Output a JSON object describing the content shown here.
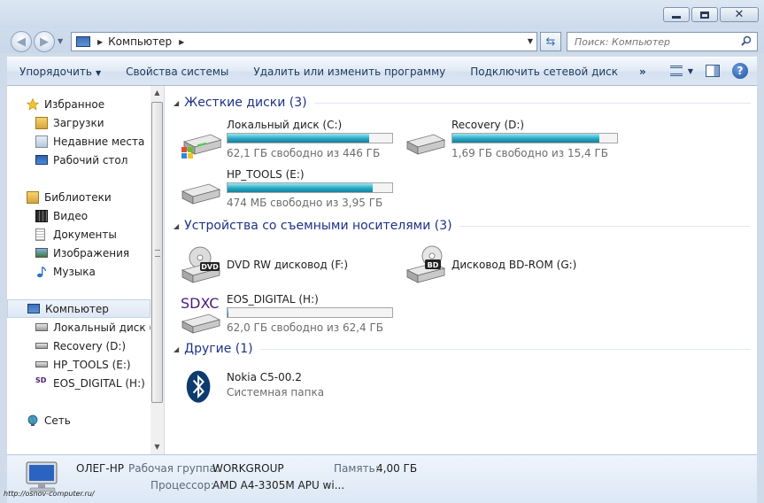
{
  "window": {
    "close_glyph": "✕"
  },
  "nav": {
    "back_glyph": "◀",
    "forward_glyph": "▶",
    "address_path": "Компьютер",
    "search_placeholder": "Поиск: Компьютер"
  },
  "commandbar": {
    "organize": "Упорядочить",
    "system_properties": "Свойства системы",
    "uninstall": "Удалить или изменить программу",
    "map_drive": "Подключить сетевой диск",
    "more": "»",
    "help": "?"
  },
  "sidebar": {
    "favorites": {
      "label": "Избранное",
      "items": [
        {
          "label": "Загрузки",
          "icon": "downloads-icon"
        },
        {
          "label": "Недавние места",
          "icon": "recent-places-icon"
        },
        {
          "label": "Рабочий стол",
          "icon": "desktop-icon"
        }
      ]
    },
    "libraries": {
      "label": "Библиотеки",
      "items": [
        {
          "label": "Видео",
          "icon": "video-icon"
        },
        {
          "label": "Документы",
          "icon": "documents-icon"
        },
        {
          "label": "Изображения",
          "icon": "pictures-icon"
        },
        {
          "label": "Музыка",
          "icon": "music-icon"
        }
      ]
    },
    "computer": {
      "label": "Компьютер",
      "items": [
        {
          "label": "Локальный диск (C:)",
          "icon": "local-disk-icon"
        },
        {
          "label": "Recovery (D:)",
          "icon": "drive-icon"
        },
        {
          "label": "HP_TOOLS (E:)",
          "icon": "drive-icon"
        },
        {
          "label": "EOS_DIGITAL (H:)",
          "icon": "sd-card-icon"
        }
      ]
    },
    "network": {
      "label": "Сеть"
    }
  },
  "content": {
    "hard_disks": {
      "title": "Жесткие диски (3)",
      "drives": [
        {
          "name": "Локальный диск (C:)",
          "free": "62,1 ГБ свободно из 446 ГБ",
          "used_fraction": 0.86
        },
        {
          "name": "Recovery (D:)",
          "free": "1,69 ГБ свободно из 15,4 ГБ",
          "used_fraction": 0.89
        },
        {
          "name": "HP_TOOLS (E:)",
          "free": "474 МБ свободно из 3,95 ГБ",
          "used_fraction": 0.88
        }
      ]
    },
    "removable": {
      "title": "Устройства со съемными носителями (3)",
      "dvd": {
        "name": "DVD RW дисковод (F:)",
        "badge": "DVD"
      },
      "bd": {
        "name": "Дисковод BD-ROM (G:)",
        "badge": "BD"
      },
      "sd": {
        "name": "EOS_DIGITAL (H:)",
        "free": "62,0 ГБ свободно из 62,4 ГБ",
        "used_fraction": 0.006,
        "logo": "SDXC"
      }
    },
    "other": {
      "title": "Другие (1)",
      "device": {
        "name": "Nokia C5-00.2",
        "type": "Системная папка"
      }
    }
  },
  "details": {
    "computer_name": "ОЛЕГ-HP",
    "workgroup_label": "Рабочая группа:",
    "workgroup": "WORKGROUP",
    "memory_label": "Память:",
    "memory": "4,00 ГБ",
    "cpu_label": "Процессор:",
    "cpu": "AMD A4-3305M APU wi..."
  },
  "watermark": "http://osnov-computer.ru/",
  "colors": {
    "group_title": "#1e3287",
    "bar_fill": "#27a8c3",
    "window_frame": "#cfdbe9"
  }
}
